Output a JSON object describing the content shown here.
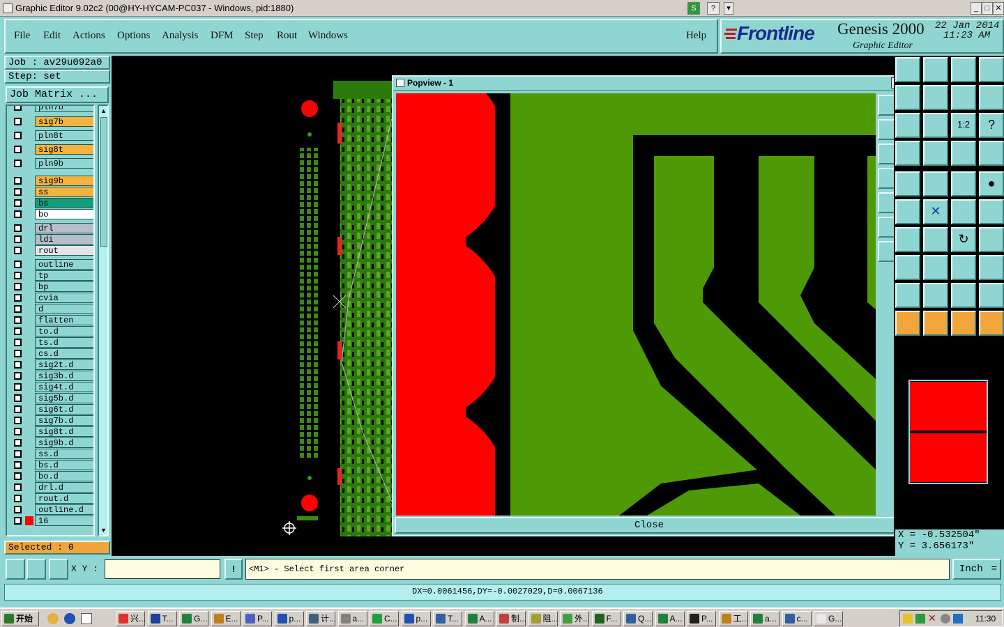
{
  "window": {
    "title": "Graphic Editor 9.02c2 (00@HY-HYCAM-PC037 - Windows, pid:1880)"
  },
  "menu": [
    "File",
    "Edit",
    "Actions",
    "Options",
    "Analysis",
    "DFM",
    "Step",
    "Rout",
    "Windows"
  ],
  "help": "Help",
  "brand": {
    "logo": "Frontline",
    "product": "Genesis 2000",
    "subtitle": "Graphic Editor",
    "date": "22 Jan 2014",
    "time": "11:23 AM"
  },
  "job": {
    "job_label": "Job : av29u092a0",
    "step_label": "Step: set",
    "matrix_button": "Job Matrix ..."
  },
  "layers": [
    {
      "name": "pln7b",
      "color": "#8fd6d2"
    },
    {
      "name": "sig7b",
      "color": "#f5b240"
    },
    {
      "name": "pln8t",
      "color": "#8fd6d2"
    },
    {
      "name": "sig8t",
      "color": "#f5b240"
    },
    {
      "name": "pln9b",
      "color": "#8fd6d2"
    },
    {
      "name": "sig9b",
      "color": "#f5b240"
    },
    {
      "name": "ss",
      "color": "#f5b240"
    },
    {
      "name": "bs",
      "color": "#149c7c"
    },
    {
      "name": "bo",
      "color": "#ffffff"
    },
    {
      "name": "drl",
      "color": "#b8bec8"
    },
    {
      "name": "ldi",
      "color": "#b8bec8"
    },
    {
      "name": "rout",
      "color": "#e4e4e4"
    },
    {
      "name": "outline",
      "color": "#8fd6d2"
    },
    {
      "name": "tp",
      "color": "#8fd6d2"
    },
    {
      "name": "bp",
      "color": "#8fd6d2"
    },
    {
      "name": "cvia",
      "color": "#8fd6d2"
    },
    {
      "name": "d",
      "color": "#8fd6d2"
    },
    {
      "name": "flatten",
      "color": "#8fd6d2"
    },
    {
      "name": "to.d",
      "color": "#8fd6d2"
    },
    {
      "name": "ts.d",
      "color": "#8fd6d2"
    },
    {
      "name": "cs.d",
      "color": "#8fd6d2"
    },
    {
      "name": "sig2t.d",
      "color": "#8fd6d2"
    },
    {
      "name": "sig3b.d",
      "color": "#8fd6d2"
    },
    {
      "name": "sig4t.d",
      "color": "#8fd6d2"
    },
    {
      "name": "sig5b.d",
      "color": "#8fd6d2"
    },
    {
      "name": "sig6t.d",
      "color": "#8fd6d2"
    },
    {
      "name": "sig7b.d",
      "color": "#8fd6d2"
    },
    {
      "name": "sig8t.d",
      "color": "#8fd6d2"
    },
    {
      "name": "sig9b.d",
      "color": "#8fd6d2"
    },
    {
      "name": "ss.d",
      "color": "#8fd6d2"
    },
    {
      "name": "bs.d",
      "color": "#8fd6d2"
    },
    {
      "name": "bo.d",
      "color": "#8fd6d2"
    },
    {
      "name": "drl.d",
      "color": "#8fd6d2"
    },
    {
      "name": "rout.d",
      "color": "#8fd6d2"
    },
    {
      "name": "outline.d",
      "color": "#8fd6d2"
    },
    {
      "name": "16",
      "color": "#8fd6d2",
      "marker": "#ff0000"
    }
  ],
  "selected": "Selected : 0",
  "popview": {
    "title": "Popview - 1",
    "close_label": "Close"
  },
  "coords": {
    "x": "X = -0.532504\"",
    "y": "Y = 3.656173\""
  },
  "cmd": {
    "xy_label": "X Y :",
    "xy_value": "",
    "prompt": "<M1> - Select first area corner",
    "units": "Inch"
  },
  "status": "DX=0.0061456,DY=-0.0027029,D=0.0067136",
  "taskbar": {
    "start": "开始",
    "items": [
      "兴...",
      "T...",
      "G...",
      "E...",
      "P...",
      "p...",
      "计...",
      "a...",
      "C...",
      "p...",
      "T...",
      "A...",
      "制...",
      "阻...",
      "外...",
      "F...",
      "Q...",
      "A...",
      "P...",
      "工...",
      "a...",
      "c...",
      "G..."
    ],
    "clock": "11:30"
  }
}
